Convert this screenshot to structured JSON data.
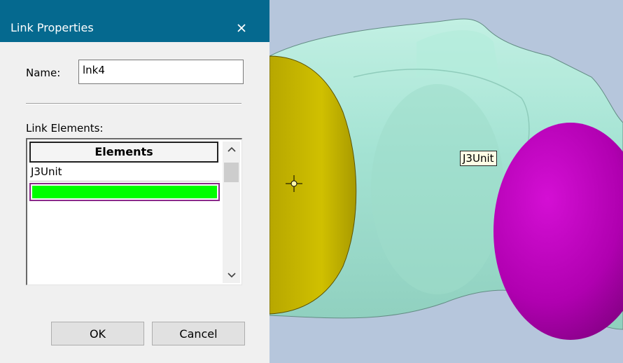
{
  "dialog": {
    "title": "Link Properties",
    "close_icon": "close-icon",
    "name_label": "Name:",
    "name_value": "lnk4",
    "elements_label": "Link Elements:",
    "grid": {
      "header": "Elements",
      "rows": [
        "J3Unit",
        ""
      ],
      "selected_row_color": "#00ff00"
    },
    "ok_label": "OK",
    "cancel_label": "Cancel"
  },
  "viewport": {
    "tooltip": "J3Unit",
    "colors": {
      "background": "#b6c6dc",
      "body": "#a6e6d4",
      "yellow_joint": "#cbbc00",
      "magenta_joint": "#c000c0"
    }
  },
  "theme": {
    "titlebar": "#05698f",
    "dialog_bg": "#f0f0f0"
  }
}
